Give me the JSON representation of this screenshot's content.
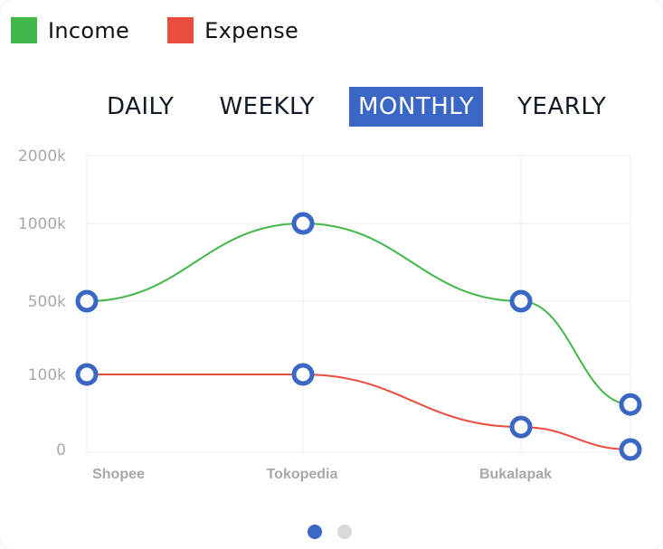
{
  "legend": [
    {
      "label": "Income",
      "color": "#43b749"
    },
    {
      "label": "Expense",
      "color": "#ea4c3d"
    }
  ],
  "tabs": [
    {
      "label": "DAILY",
      "active": false
    },
    {
      "label": "WEEKLY",
      "active": false
    },
    {
      "label": "MONTHLY",
      "active": true
    },
    {
      "label": "YEARLY",
      "active": false
    }
  ],
  "colors": {
    "accent": "#3a66c6",
    "marker": "#3a66c6"
  },
  "pager": {
    "count": 2,
    "active_index": 0,
    "active_color": "#3a66c6",
    "inactive_color": "#d9d9d9"
  },
  "chart_data": {
    "type": "line",
    "categories": [
      "Shopee",
      "Tokopedia",
      "Bukalapak",
      ""
    ],
    "y_tick_labels": [
      "0",
      "100k",
      "500k",
      "1000k",
      "2000k"
    ],
    "series": [
      {
        "name": "Income",
        "color": "#43b749",
        "values": [
          500000,
          1000000,
          500000,
          60000
        ]
      },
      {
        "name": "Expense",
        "color": "#ea4c3d",
        "values": [
          100000,
          100000,
          30000,
          0
        ]
      }
    ],
    "grid": true,
    "legend_position": "top-left"
  }
}
